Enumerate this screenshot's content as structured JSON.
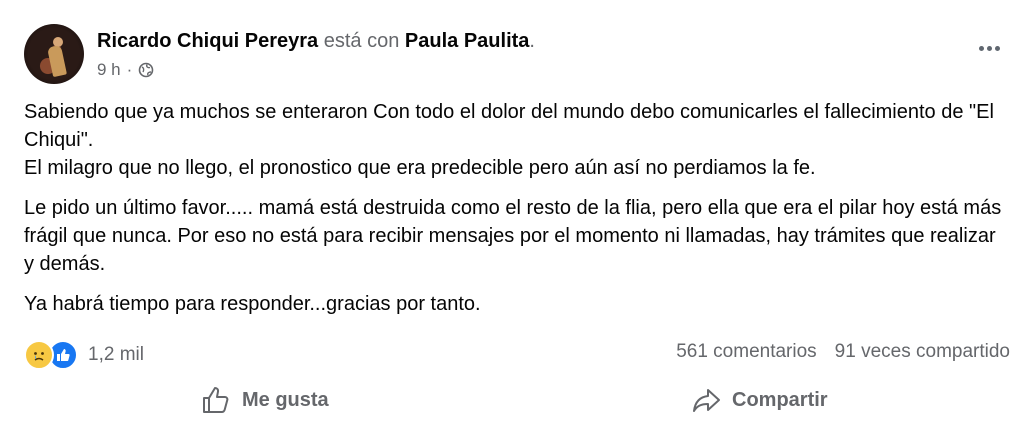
{
  "post": {
    "author": "Ricardo Chiqui Pereyra",
    "with_text": "está con",
    "tagged": "Paula Paulita",
    "tagged_suffix": ".",
    "time": "9 h",
    "dot": "·",
    "privacy_icon": "globe-icon",
    "paragraphs": [
      "Sabiendo que ya muchos se enteraron Con todo el dolor del mundo debo comunicarles el fallecimiento de \"El Chiqui\".",
      "El milagro que no llego, el pronostico que era predecible pero aún así no perdiamos la fe.",
      "Le pido un último favor..... mamá está destruida como el resto de la flia, pero ella que era el pilar hoy está más frágil que nunca. Por eso  no está para recibir mensajes por el momento ni llamadas, hay trámites que realizar y demás.",
      "Ya habrá tiempo para responder...gracias por tanto."
    ]
  },
  "stats": {
    "reactions": [
      "sad-reaction-icon",
      "like-reaction-icon"
    ],
    "reaction_count": "1,2 mil",
    "comments": "561 comentarios",
    "shares": "91 veces compartido"
  },
  "actions": {
    "like_label": "Me gusta",
    "share_label": "Compartir"
  },
  "colors": {
    "muted": "#65676b",
    "text": "#050505",
    "like_blue": "#1877f2",
    "sad_yellow": "#f7c843"
  }
}
